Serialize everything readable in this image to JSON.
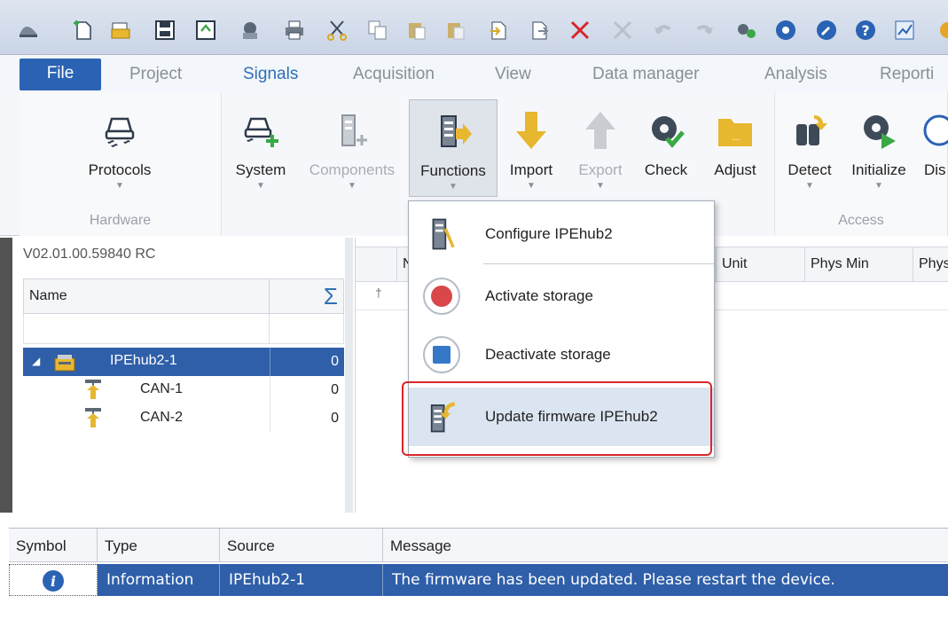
{
  "tabs": {
    "file": "File",
    "project": "Project",
    "signals": "Signals",
    "acquisition": "Acquisition",
    "view": "View",
    "data_manager": "Data manager",
    "analysis": "Analysis",
    "reporting": "Reporti"
  },
  "ribbon": {
    "hardware_group": "Hardware",
    "access_group": "Access",
    "buttons": {
      "protocols": "Protocols",
      "system": "System",
      "components": "Components",
      "functions": "Functions",
      "import": "Import",
      "export": "Export",
      "check": "Check",
      "adjust": "Adjust",
      "detect": "Detect",
      "initialize": "Initialize",
      "dis": "Dis"
    }
  },
  "tree": {
    "version": "V02.01.00.59840 RC",
    "name_header": "Name",
    "sum_header": "Σ",
    "items": [
      {
        "name": "IPEhub2-1",
        "value": "0"
      },
      {
        "name": "CAN-1",
        "value": "0"
      },
      {
        "name": "CAN-2",
        "value": "0"
      }
    ]
  },
  "grid": {
    "columns": [
      "N",
      "Unit",
      "Phys Min",
      "Phys"
    ],
    "filter_pin": "†"
  },
  "menu": {
    "items": [
      "Configure IPEhub2",
      "Activate storage",
      "Deactivate storage",
      "Update firmware IPEhub2"
    ]
  },
  "log": {
    "headers": [
      "Symbol",
      "Type",
      "Source",
      "Message"
    ],
    "row": {
      "symbol": "i",
      "type": "Information",
      "source": "IPEhub2-1",
      "message": "The firmware has been updated. Please restart the device."
    }
  },
  "colors": {
    "accent": "#2b63b4",
    "selection": "#2f5fa9",
    "highlight_box": "#d9262b"
  }
}
